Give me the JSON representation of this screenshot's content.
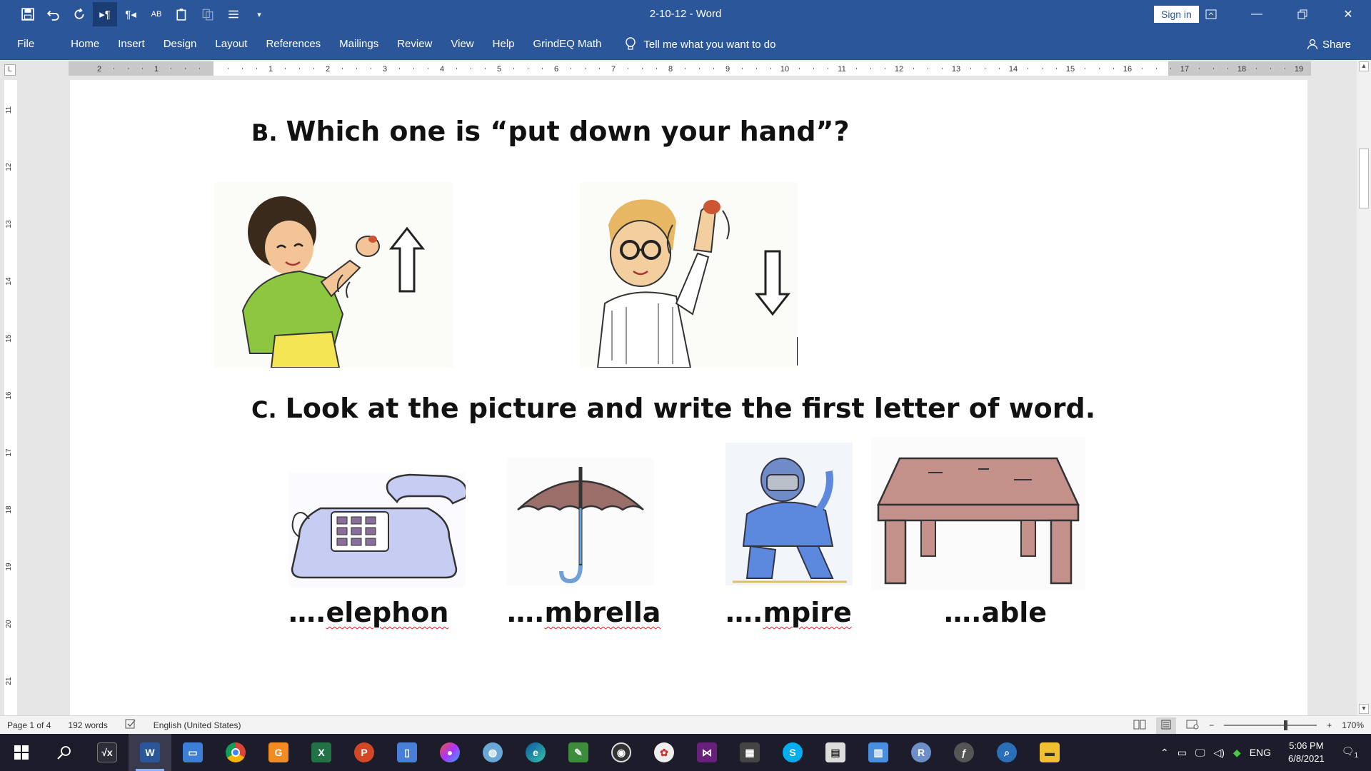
{
  "window": {
    "title": "2-10-12  -  Word",
    "signin_label": "Sign in"
  },
  "ribbon": {
    "tabs": [
      "File",
      "Home",
      "Insert",
      "Design",
      "Layout",
      "References",
      "Mailings",
      "Review",
      "View",
      "Help",
      "GrindEQ Math"
    ],
    "tell_me": "Tell me what you want to do",
    "share": "Share"
  },
  "ruler": {
    "h_numbers": [
      "2",
      "1",
      "1",
      "2",
      "3",
      "4",
      "5",
      "6",
      "7",
      "8",
      "9",
      "10",
      "11",
      "12",
      "13",
      "14",
      "15",
      "16",
      "17",
      "18",
      "19"
    ],
    "v_numbers": [
      "11",
      "12",
      "13",
      "14",
      "15",
      "16",
      "17",
      "18",
      "19",
      "20",
      "21"
    ],
    "corner": "L"
  },
  "document": {
    "section_b": {
      "letter": "B.",
      "text": "Which one is “put down your hand”?"
    },
    "section_c": {
      "letter": "C.",
      "text": "Look at the picture and write the first letter of word."
    },
    "words": [
      {
        "prefix": "….",
        "rest": "elephon",
        "misspelled": true
      },
      {
        "prefix": "….",
        "rest": "mbrella",
        "misspelled": true
      },
      {
        "prefix": "….",
        "rest": "mpire",
        "misspelled": true
      },
      {
        "prefix": "….",
        "rest": "able",
        "misspelled": false
      }
    ],
    "pictures_b": [
      "boy-raising-hand-arrow-up",
      "boy-lowering-hand-arrow-down"
    ],
    "pictures_c": [
      "telephone",
      "umbrella",
      "umpire",
      "table"
    ]
  },
  "status": {
    "page": "Page 1 of 4",
    "words": "192 words",
    "language": "English (United States)",
    "zoom": "170%",
    "zoom_minus": "−",
    "zoom_plus": "+"
  },
  "taskbar": {
    "time": "5:06 PM",
    "date": "6/8/2021",
    "lang": "ENG",
    "notif_count": "1"
  },
  "colors": {
    "word_blue": "#2b579a",
    "taskbar": "#1c1c2a"
  }
}
